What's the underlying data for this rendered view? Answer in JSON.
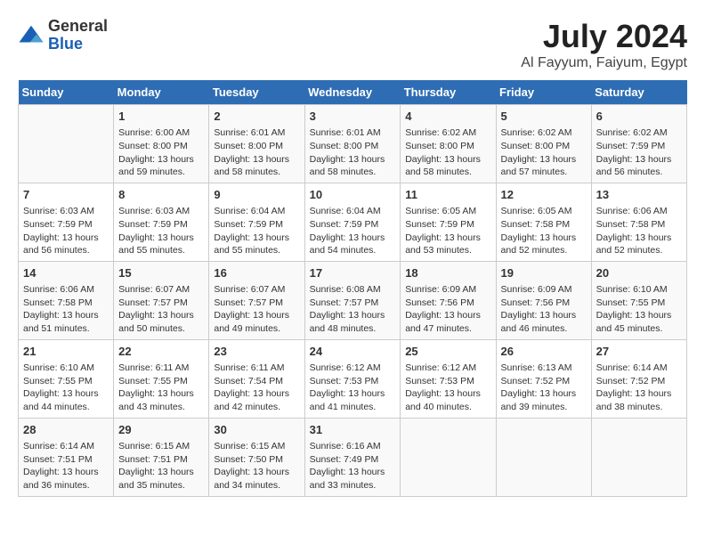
{
  "header": {
    "logo": {
      "line1": "General",
      "line2": "Blue"
    },
    "title": "July 2024",
    "location": "Al Fayyum, Faiyum, Egypt"
  },
  "calendar": {
    "headers": [
      "Sunday",
      "Monday",
      "Tuesday",
      "Wednesday",
      "Thursday",
      "Friday",
      "Saturday"
    ],
    "weeks": [
      [
        {
          "day": "",
          "info": ""
        },
        {
          "day": "1",
          "info": "Sunrise: 6:00 AM\nSunset: 8:00 PM\nDaylight: 13 hours\nand 59 minutes."
        },
        {
          "day": "2",
          "info": "Sunrise: 6:01 AM\nSunset: 8:00 PM\nDaylight: 13 hours\nand 58 minutes."
        },
        {
          "day": "3",
          "info": "Sunrise: 6:01 AM\nSunset: 8:00 PM\nDaylight: 13 hours\nand 58 minutes."
        },
        {
          "day": "4",
          "info": "Sunrise: 6:02 AM\nSunset: 8:00 PM\nDaylight: 13 hours\nand 58 minutes."
        },
        {
          "day": "5",
          "info": "Sunrise: 6:02 AM\nSunset: 8:00 PM\nDaylight: 13 hours\nand 57 minutes."
        },
        {
          "day": "6",
          "info": "Sunrise: 6:02 AM\nSunset: 7:59 PM\nDaylight: 13 hours\nand 56 minutes."
        }
      ],
      [
        {
          "day": "7",
          "info": "Sunrise: 6:03 AM\nSunset: 7:59 PM\nDaylight: 13 hours\nand 56 minutes."
        },
        {
          "day": "8",
          "info": "Sunrise: 6:03 AM\nSunset: 7:59 PM\nDaylight: 13 hours\nand 55 minutes."
        },
        {
          "day": "9",
          "info": "Sunrise: 6:04 AM\nSunset: 7:59 PM\nDaylight: 13 hours\nand 55 minutes."
        },
        {
          "day": "10",
          "info": "Sunrise: 6:04 AM\nSunset: 7:59 PM\nDaylight: 13 hours\nand 54 minutes."
        },
        {
          "day": "11",
          "info": "Sunrise: 6:05 AM\nSunset: 7:59 PM\nDaylight: 13 hours\nand 53 minutes."
        },
        {
          "day": "12",
          "info": "Sunrise: 6:05 AM\nSunset: 7:58 PM\nDaylight: 13 hours\nand 52 minutes."
        },
        {
          "day": "13",
          "info": "Sunrise: 6:06 AM\nSunset: 7:58 PM\nDaylight: 13 hours\nand 52 minutes."
        }
      ],
      [
        {
          "day": "14",
          "info": "Sunrise: 6:06 AM\nSunset: 7:58 PM\nDaylight: 13 hours\nand 51 minutes."
        },
        {
          "day": "15",
          "info": "Sunrise: 6:07 AM\nSunset: 7:57 PM\nDaylight: 13 hours\nand 50 minutes."
        },
        {
          "day": "16",
          "info": "Sunrise: 6:07 AM\nSunset: 7:57 PM\nDaylight: 13 hours\nand 49 minutes."
        },
        {
          "day": "17",
          "info": "Sunrise: 6:08 AM\nSunset: 7:57 PM\nDaylight: 13 hours\nand 48 minutes."
        },
        {
          "day": "18",
          "info": "Sunrise: 6:09 AM\nSunset: 7:56 PM\nDaylight: 13 hours\nand 47 minutes."
        },
        {
          "day": "19",
          "info": "Sunrise: 6:09 AM\nSunset: 7:56 PM\nDaylight: 13 hours\nand 46 minutes."
        },
        {
          "day": "20",
          "info": "Sunrise: 6:10 AM\nSunset: 7:55 PM\nDaylight: 13 hours\nand 45 minutes."
        }
      ],
      [
        {
          "day": "21",
          "info": "Sunrise: 6:10 AM\nSunset: 7:55 PM\nDaylight: 13 hours\nand 44 minutes."
        },
        {
          "day": "22",
          "info": "Sunrise: 6:11 AM\nSunset: 7:55 PM\nDaylight: 13 hours\nand 43 minutes."
        },
        {
          "day": "23",
          "info": "Sunrise: 6:11 AM\nSunset: 7:54 PM\nDaylight: 13 hours\nand 42 minutes."
        },
        {
          "day": "24",
          "info": "Sunrise: 6:12 AM\nSunset: 7:53 PM\nDaylight: 13 hours\nand 41 minutes."
        },
        {
          "day": "25",
          "info": "Sunrise: 6:12 AM\nSunset: 7:53 PM\nDaylight: 13 hours\nand 40 minutes."
        },
        {
          "day": "26",
          "info": "Sunrise: 6:13 AM\nSunset: 7:52 PM\nDaylight: 13 hours\nand 39 minutes."
        },
        {
          "day": "27",
          "info": "Sunrise: 6:14 AM\nSunset: 7:52 PM\nDaylight: 13 hours\nand 38 minutes."
        }
      ],
      [
        {
          "day": "28",
          "info": "Sunrise: 6:14 AM\nSunset: 7:51 PM\nDaylight: 13 hours\nand 36 minutes."
        },
        {
          "day": "29",
          "info": "Sunrise: 6:15 AM\nSunset: 7:51 PM\nDaylight: 13 hours\nand 35 minutes."
        },
        {
          "day": "30",
          "info": "Sunrise: 6:15 AM\nSunset: 7:50 PM\nDaylight: 13 hours\nand 34 minutes."
        },
        {
          "day": "31",
          "info": "Sunrise: 6:16 AM\nSunset: 7:49 PM\nDaylight: 13 hours\nand 33 minutes."
        },
        {
          "day": "",
          "info": ""
        },
        {
          "day": "",
          "info": ""
        },
        {
          "day": "",
          "info": ""
        }
      ]
    ]
  }
}
